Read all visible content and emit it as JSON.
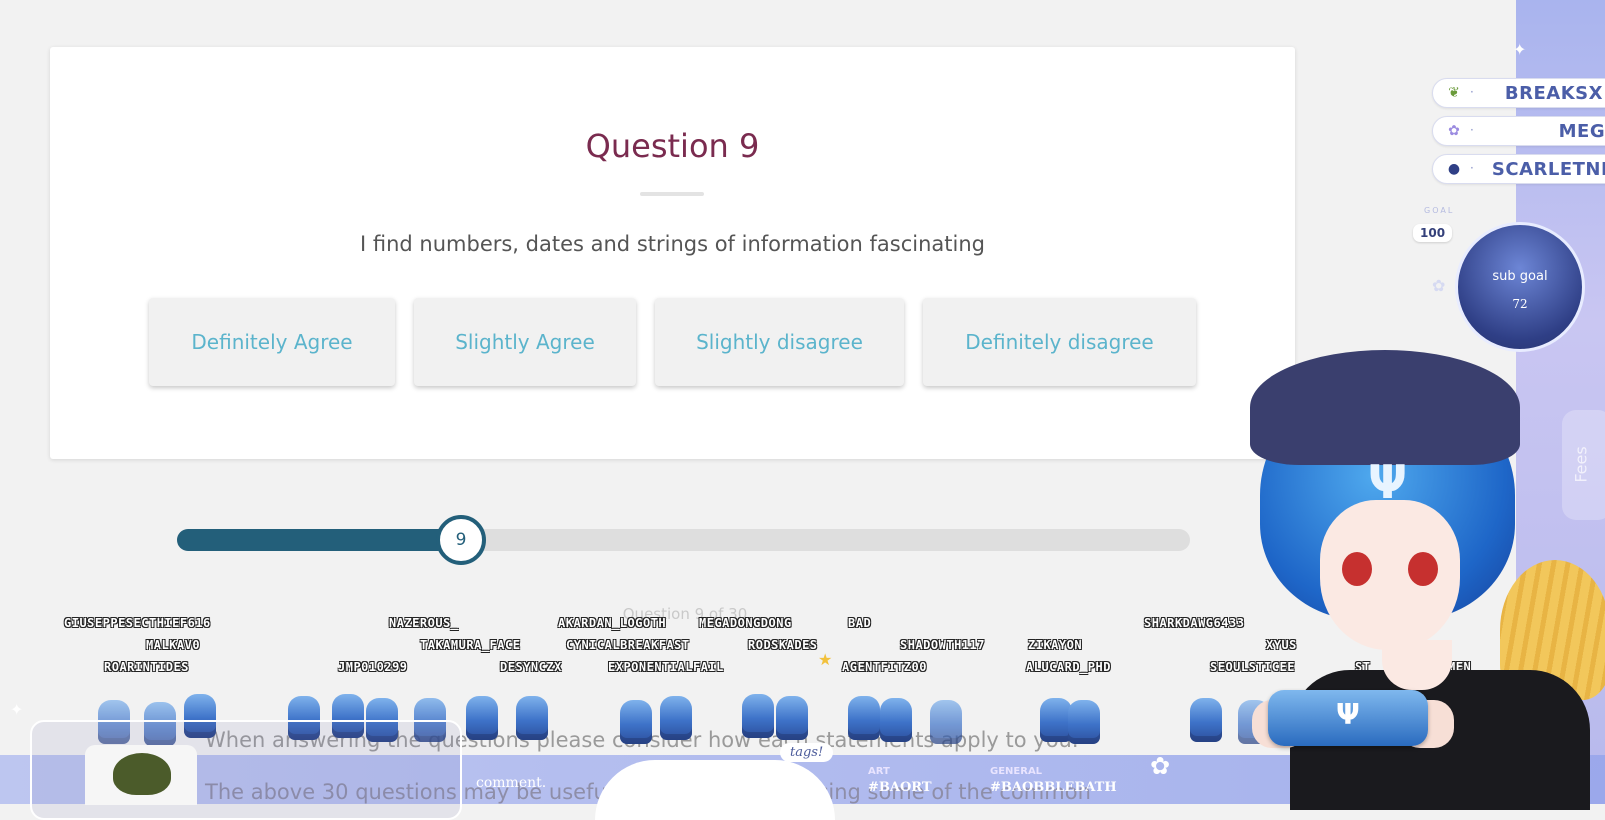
{
  "quiz": {
    "title": "Question 9",
    "question": "I find numbers, dates and strings of information fascinating",
    "answers": [
      "Definitely Agree",
      "Slightly Agree",
      "Slightly disagree",
      "Definitely disagree"
    ],
    "progress_caption": "Question 9 of 30",
    "progress": {
      "current": "9",
      "fraction": 0.28
    },
    "footnote_1": "When answering the questions please consider how each statements apply to you.",
    "footnote_2": "The above 30 questions may be useful to people experiencing some of the common"
  },
  "overlay": {
    "viewers": [
      "GIUSEPPESECTHIEF616",
      "MALKAV0",
      "ROARINTIDES",
      "NAZEROUS_",
      "TAKAMURA_FACE",
      "JMP010299",
      "DESYNCZX",
      "AKARDAN_LOGOTH",
      "MEGADONGDONG",
      "CYNICALBREAKFAST",
      "EXPONENTIALFAIL",
      "BAD",
      "RODSKADES",
      "SHADOWTH117",
      "AGENTFITZ00",
      "ZIKAYON",
      "ALUCARD_PHD",
      "SHARKDAWG6433",
      "XYUS",
      "SEOULSTICEE",
      "ST",
      "MEN"
    ],
    "subs": [
      {
        "icon": "sprout-icon",
        "name": "BREAKSX"
      },
      {
        "icon": "flower-icon",
        "name": "MEGAD"
      },
      {
        "icon": "berry-icon",
        "name": "SCARLETNIGH"
      }
    ],
    "goal": {
      "caption": "GOAL",
      "target": "100",
      "title": "sub goal",
      "current": "72"
    },
    "chat_label": "comment.",
    "tags_label": "tags!",
    "categories": [
      {
        "label": "ART",
        "tag": "#BAORT"
      },
      {
        "label": "GENERAL",
        "tag": "#BAOBBLEBATH"
      }
    ],
    "side_tab": "Fees"
  },
  "colors": {
    "title": "#7a2b4f",
    "answer_text": "#5bb4cc",
    "progress": "#235f7a",
    "track": "#dedede"
  }
}
